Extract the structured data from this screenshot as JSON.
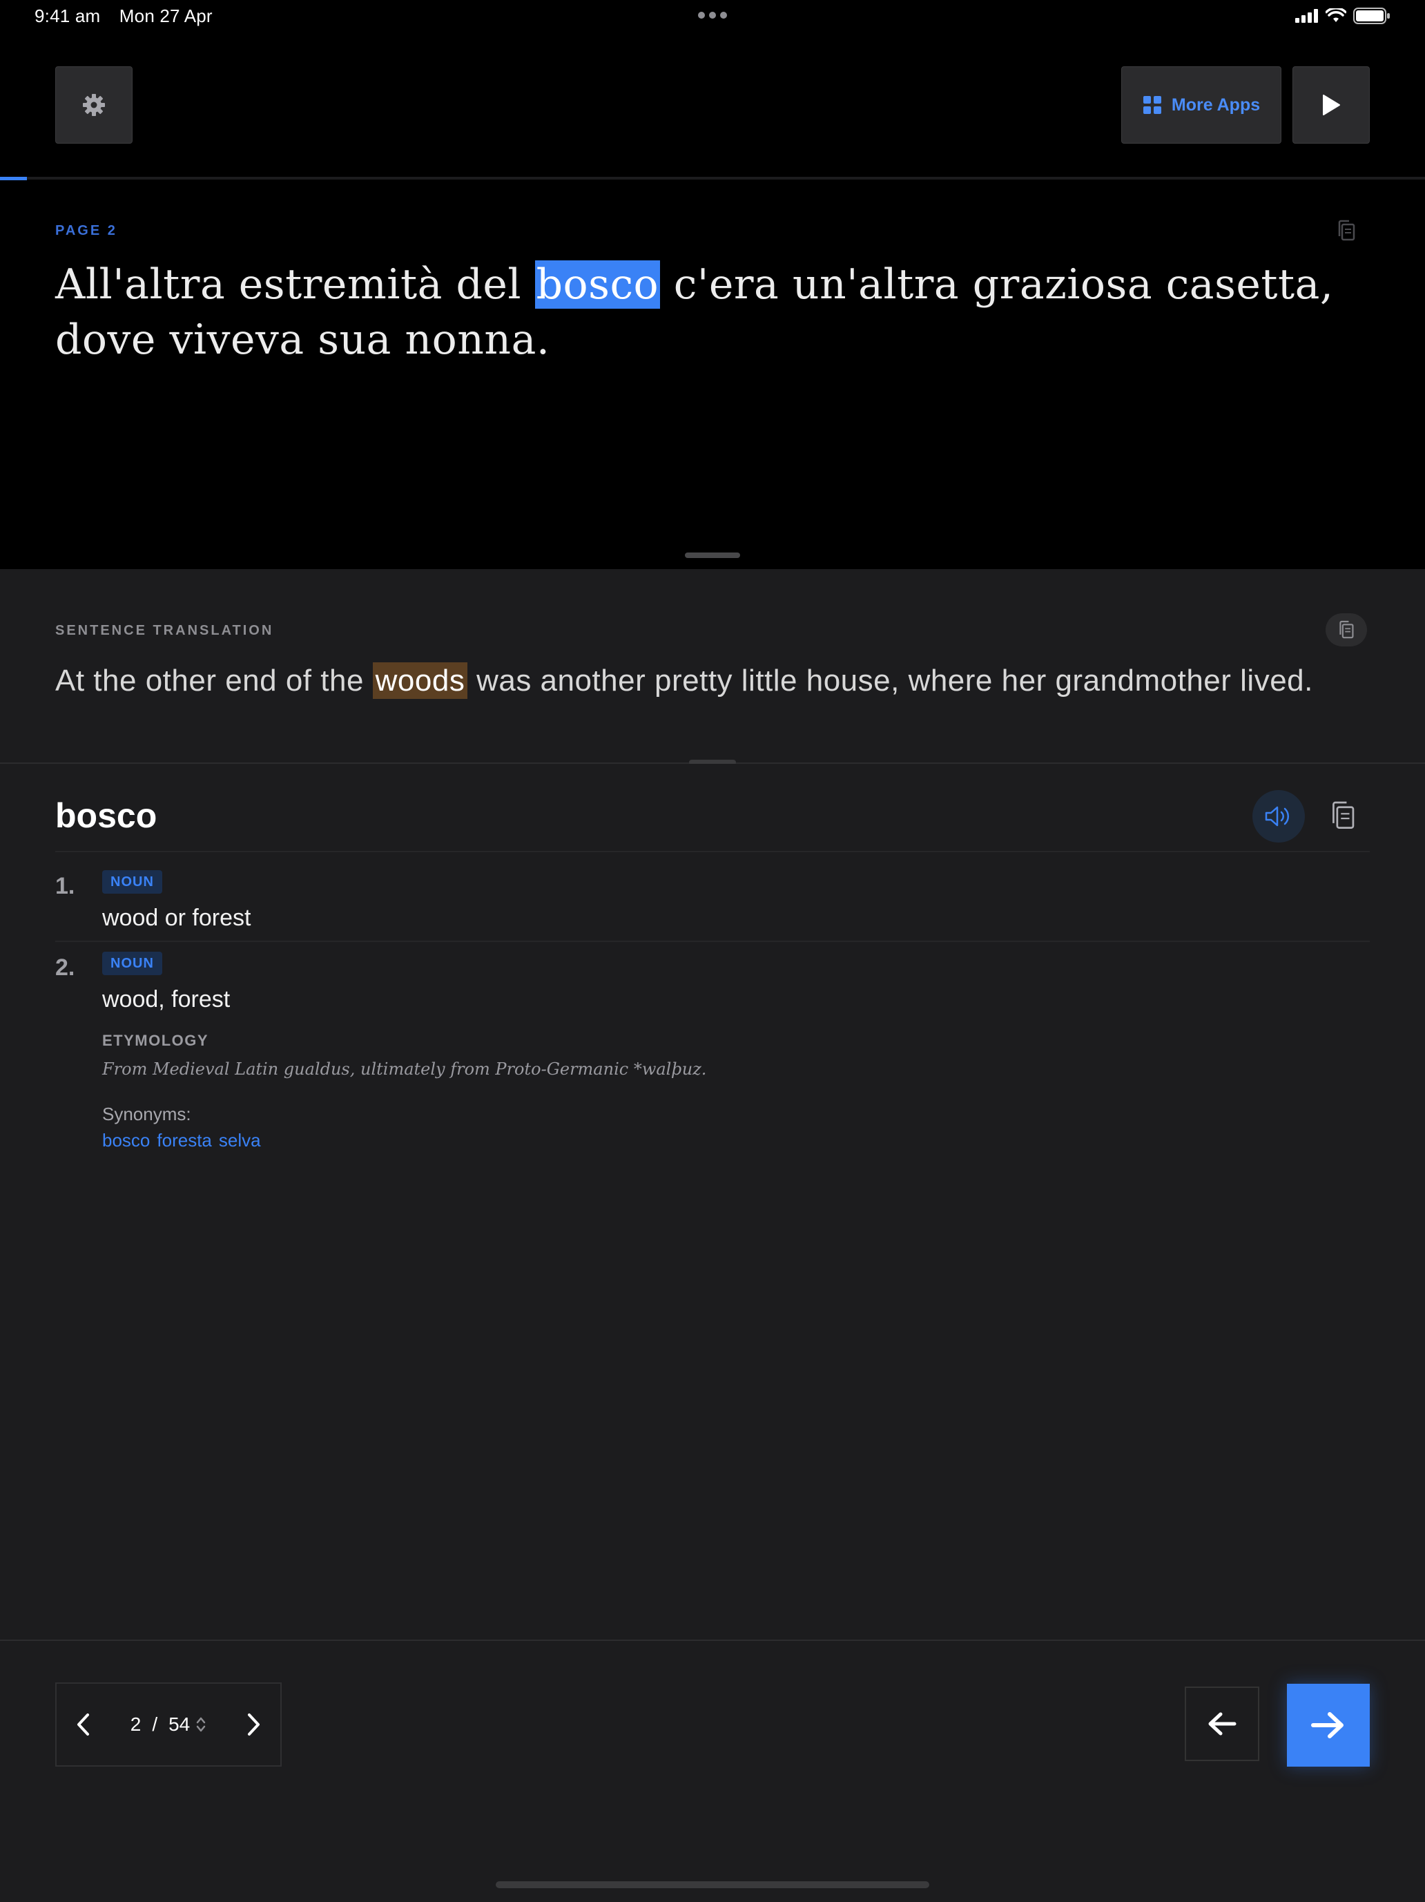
{
  "status_bar": {
    "time": "9:41 am",
    "date": "Mon 27 Apr"
  },
  "toolbar": {
    "more_apps_label": "More Apps"
  },
  "reader": {
    "progress": 0.019,
    "page_label": "PAGE",
    "page_number": "2",
    "sentence_parts": [
      "All'altra estremità del ",
      "bosco",
      " c'era un'altra graziosa casetta, dove viveva sua nonna."
    ]
  },
  "translation": {
    "label": "SENTENCE TRANSLATION",
    "sentence_parts": [
      "At the other end of the ",
      "woods",
      " was another pretty little house, where her grandmother lived."
    ]
  },
  "dictionary": {
    "headword": "bosco",
    "senses": [
      {
        "number": "1.",
        "pos": "NOUN",
        "gloss": "wood or forest"
      },
      {
        "number": "2.",
        "pos": "NOUN",
        "gloss": "wood, forest"
      }
    ],
    "etymology_label": "ETYMOLOGY",
    "etymology_text": "From Medieval Latin gualdus, ultimately from Proto-Germanic *walþuz.",
    "synonyms_label": "Synonyms:",
    "synonyms": [
      "bosco",
      "foresta",
      "selva"
    ]
  },
  "pager": {
    "current": "2",
    "separator": "/",
    "total": "54"
  },
  "colors": {
    "accent": "#3a82f6",
    "source_highlight": "#3a82f6",
    "translation_highlight": "#5b3f22",
    "panel_bg": "#1c1c1e"
  }
}
